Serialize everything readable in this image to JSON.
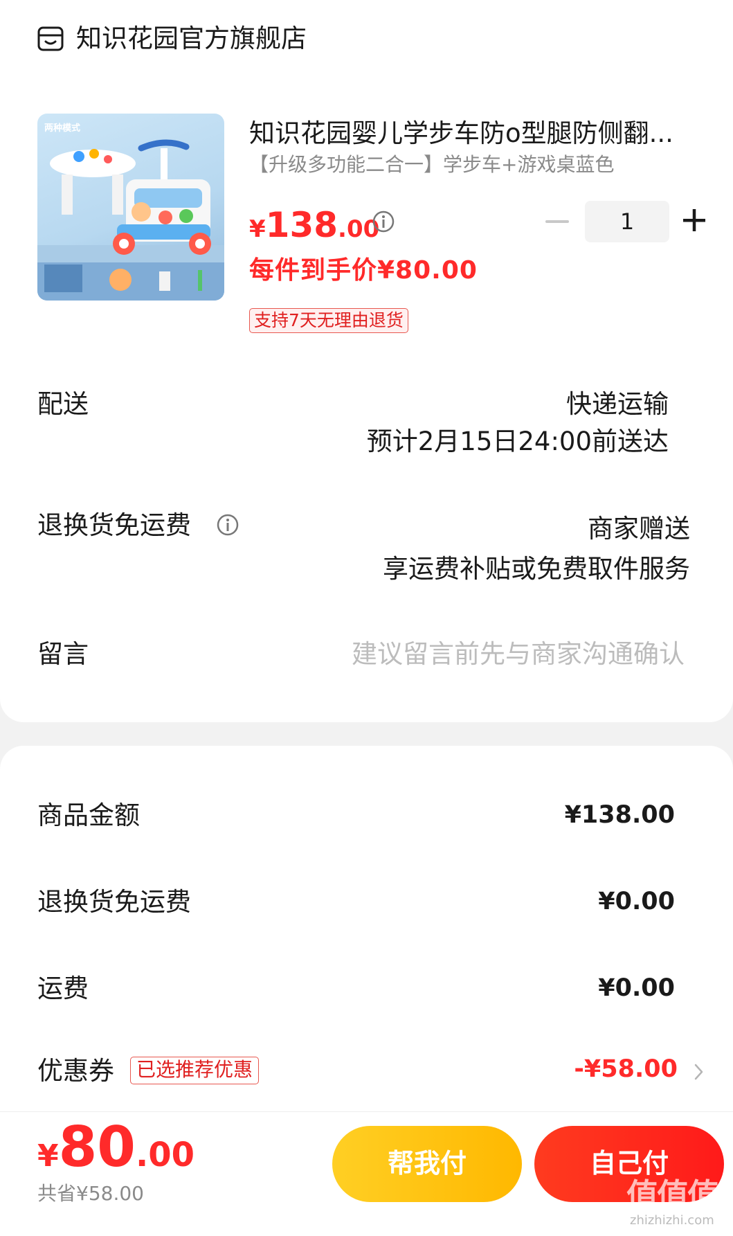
{
  "store": {
    "icon": "store-icon",
    "name": "知识花园官方旗舰店"
  },
  "product": {
    "title": "知识花园婴儿学步车防o型腿防侧翻...",
    "sku": "【升级多功能二合一】学步车+游戏桌蓝色",
    "image_label": "两种模式",
    "price_currency": "¥",
    "price_int": "138",
    "price_dec": ".00",
    "final_price": "每件到手价¥80.00",
    "quantity": "1",
    "return_badge": "支持7天无理由退货"
  },
  "delivery": {
    "label": "配送",
    "method": "快递运输",
    "eta": "预计2月15日24:00前送达"
  },
  "return_shipping": {
    "label": "退换货免运费",
    "value": "商家赠送",
    "desc": "享运费补贴或免费取件服务"
  },
  "message": {
    "label": "留言",
    "placeholder": "建议留言前先与商家沟通确认"
  },
  "summary": {
    "goods_label": "商品金额",
    "goods_value": "¥138.00",
    "return_label": "退换货免运费",
    "return_value": "¥0.00",
    "shipping_label": "运费",
    "shipping_value": "¥0.00",
    "coupon_label": "优惠券",
    "coupon_badge": "已选推荐优惠",
    "coupon_value": "-¥58.00"
  },
  "bottom": {
    "total_currency": "¥",
    "total_int": "80",
    "total_dec": ".00",
    "saved": "共省¥58.00",
    "help_pay": "帮我付",
    "self_pay": "自己付"
  },
  "watermark": {
    "text": "值值值",
    "sub": "zhizhizhi.com"
  },
  "colors": {
    "accent_red": "#ff2a2a",
    "help_yellow": "#ffb800",
    "pay_red": "#ff1a1a"
  }
}
